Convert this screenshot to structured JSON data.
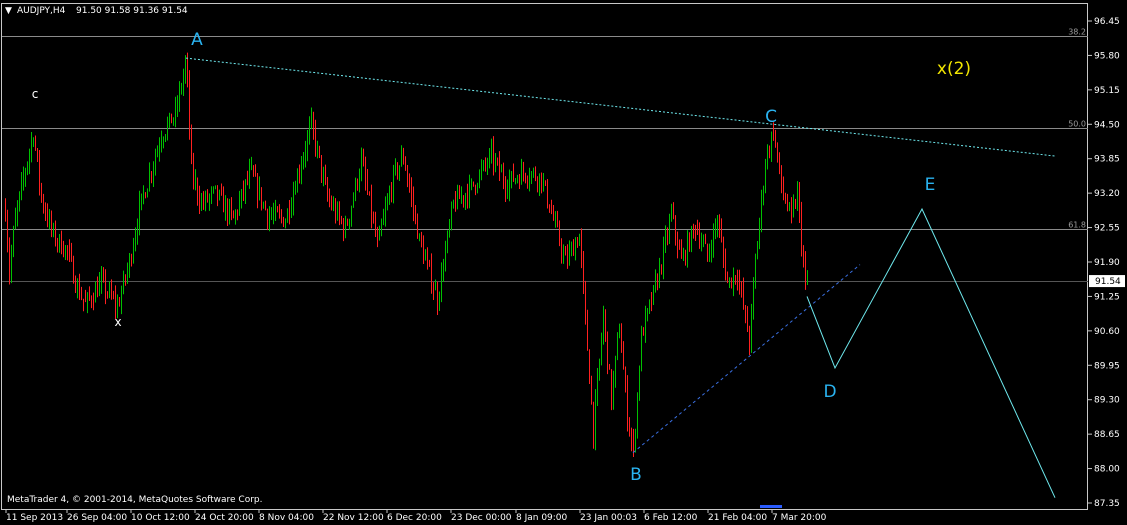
{
  "header": {
    "menu_arrow": "▼",
    "symbol_label": "AUDJPY,H4",
    "ohlc_label": "91.50 91.58 91.36 91.54"
  },
  "copyright": "MetaTrader 4, © 2001-2014, MetaQuotes Software Corp.",
  "colors": {
    "background": "#000000",
    "up_candle": "#00c000",
    "down_candle": "#ff2020",
    "fib_line": "#8a8a8a",
    "wave_line": "#6ee9ee",
    "wave_label": "#2ab3f0",
    "x2_label": "#f2e600",
    "axis_text": "#ffffff"
  },
  "chart_data": {
    "type": "candlestick",
    "symbol": "AUDJPY",
    "timeframe": "H4",
    "current_price": 91.54,
    "current_price_label": "91.54",
    "ylim": [
      87.2,
      96.75
    ],
    "y_ticks": [
      "96.45",
      "95.80",
      "95.15",
      "94.50",
      "93.85",
      "93.20",
      "92.55",
      "91.90",
      "91.25",
      "90.60",
      "89.95",
      "89.30",
      "88.65",
      "88.00",
      "87.35"
    ],
    "x_ticks": [
      "11 Sep 2013",
      "26 Sep 04:00",
      "10 Oct 12:00",
      "24 Oct 20:00",
      "8 Nov 04:00",
      "22 Nov 12:00",
      "6 Dec 20:00",
      "23 Dec 00:00",
      "8 Jan 09:00",
      "23 Jan 00:03",
      "6 Feb 12:00",
      "21 Feb 04:00",
      "7 Mar 20:00"
    ],
    "price_path": [
      {
        "t": 0,
        "p": 92.9
      },
      {
        "t": 4,
        "p": 91.7
      },
      {
        "t": 9,
        "p": 92.6
      },
      {
        "t": 16,
        "p": 93.3
      },
      {
        "t": 28,
        "p": 94.35
      },
      {
        "t": 36,
        "p": 93.1
      },
      {
        "t": 48,
        "p": 92.4
      },
      {
        "t": 62,
        "p": 92.1
      },
      {
        "t": 72,
        "p": 91.4
      },
      {
        "t": 80,
        "p": 91.1
      },
      {
        "t": 96,
        "p": 91.5
      },
      {
        "t": 112,
        "p": 91.05
      },
      {
        "t": 124,
        "p": 91.9
      },
      {
        "t": 134,
        "p": 92.9
      },
      {
        "t": 145,
        "p": 93.6
      },
      {
        "t": 156,
        "p": 94.3
      },
      {
        "t": 170,
        "p": 94.7
      },
      {
        "t": 181,
        "p": 95.7
      },
      {
        "t": 186,
        "p": 93.6
      },
      {
        "t": 196,
        "p": 93.0
      },
      {
        "t": 210,
        "p": 93.2
      },
      {
        "t": 228,
        "p": 92.7
      },
      {
        "t": 245,
        "p": 93.6
      },
      {
        "t": 262,
        "p": 92.8
      },
      {
        "t": 280,
        "p": 92.7
      },
      {
        "t": 296,
        "p": 93.8
      },
      {
        "t": 306,
        "p": 94.5
      },
      {
        "t": 322,
        "p": 93.1
      },
      {
        "t": 340,
        "p": 92.5
      },
      {
        "t": 356,
        "p": 93.8
      },
      {
        "t": 372,
        "p": 92.2
      },
      {
        "t": 388,
        "p": 93.5
      },
      {
        "t": 398,
        "p": 93.9
      },
      {
        "t": 414,
        "p": 92.3
      },
      {
        "t": 432,
        "p": 91.2
      },
      {
        "t": 448,
        "p": 93.0
      },
      {
        "t": 466,
        "p": 93.3
      },
      {
        "t": 486,
        "p": 93.9
      },
      {
        "t": 500,
        "p": 93.4
      },
      {
        "t": 520,
        "p": 93.6
      },
      {
        "t": 536,
        "p": 93.5
      },
      {
        "t": 548,
        "p": 92.7
      },
      {
        "t": 560,
        "p": 91.9
      },
      {
        "t": 574,
        "p": 92.4
      },
      {
        "t": 580,
        "p": 90.8
      },
      {
        "t": 588,
        "p": 88.7
      },
      {
        "t": 598,
        "p": 90.9
      },
      {
        "t": 606,
        "p": 89.3
      },
      {
        "t": 614,
        "p": 90.7
      },
      {
        "t": 622,
        "p": 89.0
      },
      {
        "t": 628,
        "p": 88.3
      },
      {
        "t": 636,
        "p": 90.5
      },
      {
        "t": 648,
        "p": 91.3
      },
      {
        "t": 656,
        "p": 91.9
      },
      {
        "t": 666,
        "p": 92.8
      },
      {
        "t": 676,
        "p": 91.9
      },
      {
        "t": 690,
        "p": 92.6
      },
      {
        "t": 702,
        "p": 92.0
      },
      {
        "t": 712,
        "p": 92.7
      },
      {
        "t": 722,
        "p": 91.5
      },
      {
        "t": 732,
        "p": 91.7
      },
      {
        "t": 744,
        "p": 90.4
      },
      {
        "t": 750,
        "p": 91.9
      },
      {
        "t": 760,
        "p": 93.8
      },
      {
        "t": 768,
        "p": 94.4
      },
      {
        "t": 776,
        "p": 93.3
      },
      {
        "t": 786,
        "p": 92.7
      },
      {
        "t": 792,
        "p": 93.2
      },
      {
        "t": 800,
        "p": 91.4
      },
      {
        "t": 802,
        "p": 91.54
      }
    ],
    "fib_levels": [
      {
        "label": "38.2",
        "value": 96.16
      },
      {
        "label": "50.0",
        "value": 94.43
      },
      {
        "label": "61.8",
        "value": 92.52
      }
    ],
    "wave_labels": [
      {
        "text": "A",
        "value": 95.75,
        "kind": "big"
      },
      {
        "text": "C",
        "value": 94.5,
        "kind": "big"
      },
      {
        "text": "B",
        "value": 88.3,
        "kind": "big"
      },
      {
        "text": "D",
        "value": 89.9,
        "kind": "big"
      },
      {
        "text": "E",
        "value": 92.9,
        "kind": "big"
      },
      {
        "text": "x(2)",
        "value": 95.6,
        "kind": "x2"
      },
      {
        "text": "c",
        "value": 95.0,
        "kind": "small"
      },
      {
        "text": "x",
        "value": 90.9,
        "kind": "small"
      }
    ],
    "projection_path": [
      {
        "t": 802,
        "p": 91.25
      },
      {
        "t": 830,
        "p": 89.9
      },
      {
        "t": 917,
        "p": 92.9
      },
      {
        "t": 1050,
        "p": 87.45
      }
    ],
    "trendline_AC": [
      {
        "t": 181,
        "p": 95.75
      },
      {
        "t": 1050,
        "p": 93.9
      }
    ],
    "trendline_B": [
      {
        "t": 628,
        "p": 88.3
      },
      {
        "t": 855,
        "p": 91.85
      }
    ]
  }
}
